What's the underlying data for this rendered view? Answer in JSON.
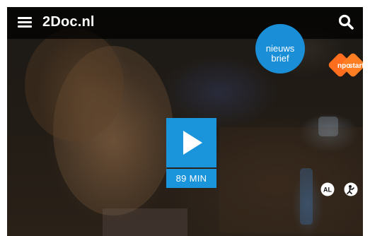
{
  "header": {
    "site_title": "2Doc.nl",
    "menu_icon": "hamburger-menu-icon",
    "search_icon": "search-icon",
    "background_color": "#000000"
  },
  "newsletter_badge": {
    "line1": "nieuws",
    "line2": "brief",
    "color": "#1a8fd8"
  },
  "npo_logo": {
    "left_text": "npo",
    "right_text": "start",
    "color": "#ff6d1f"
  },
  "video": {
    "play_icon": "play-icon",
    "duration_label": "89 MIN",
    "accent_color": "#1a95db"
  },
  "ratings": [
    {
      "icon": "age-rating-al-icon",
      "label": "AL"
    },
    {
      "icon": "fear-rating-icon"
    }
  ]
}
